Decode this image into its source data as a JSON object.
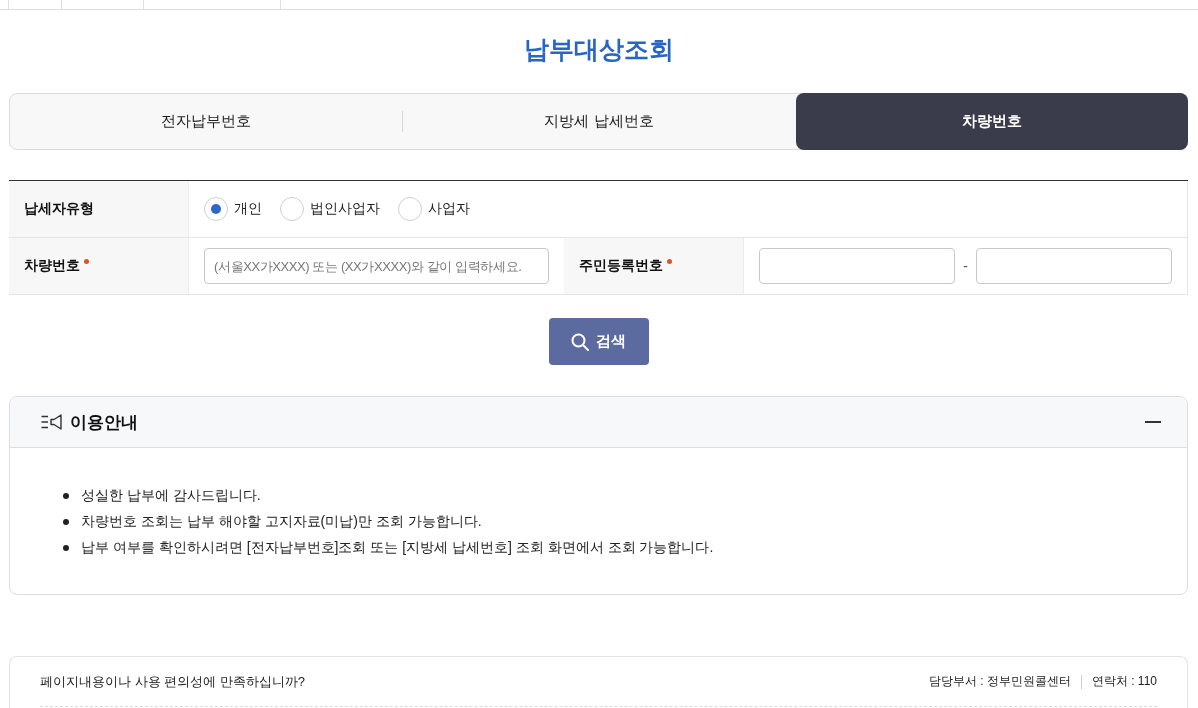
{
  "page_title": "납부대상조회",
  "tabs": [
    {
      "label": "전자납부번호",
      "selected": false
    },
    {
      "label": "지방세 납세번호",
      "selected": false
    },
    {
      "label": "차량번호",
      "selected": true
    }
  ],
  "form": {
    "taxpayer_type": {
      "label": "납세자유형",
      "options": [
        {
          "label": "개인",
          "selected": true
        },
        {
          "label": "법인사업자",
          "selected": false
        },
        {
          "label": "사업자",
          "selected": false
        }
      ]
    },
    "vehicle_number": {
      "label": "차량번호",
      "required": true,
      "placeholder": "(서울XX가XXXX) 또는 (XX가XXXX)와 같이 입력하세요."
    },
    "resident_number": {
      "label": "주민등록번호",
      "required": true,
      "separator": "-"
    }
  },
  "search_button": {
    "label": "검색"
  },
  "guide": {
    "title": "이용안내",
    "expanded": true,
    "items": [
      "성실한 납부에 감사드립니다.",
      "차량번호 조회는 납부 해야할 고지자료(미납)만 조회 가능합니다.",
      "납부 여부를 확인하시려면 [전자납부번호]조회 또는 [지방세 납세번호] 조회 화면에서 조회 가능합니다."
    ]
  },
  "feedback": {
    "question": "페이지내용이나 사용 편의성에 만족하십니까?",
    "department": "담당부서 : 정부민원콜센터",
    "contact": "연락처 : 110"
  }
}
